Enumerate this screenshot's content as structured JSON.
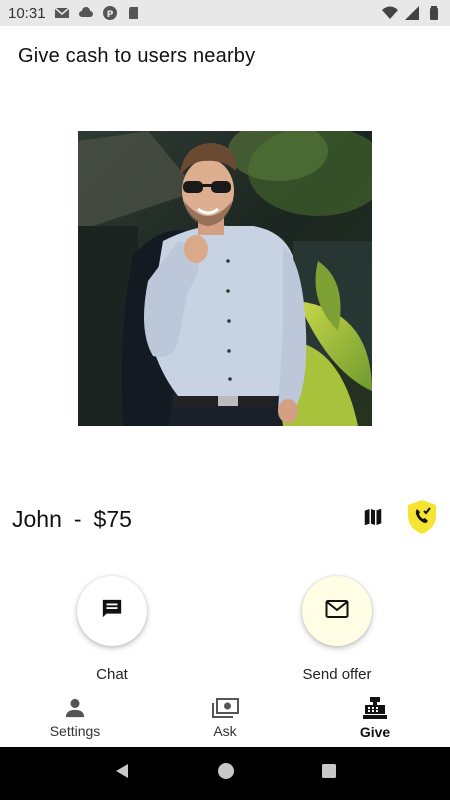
{
  "status_bar": {
    "time": "10:31"
  },
  "header": {
    "title": "Give cash to users nearby"
  },
  "profile": {
    "name": "John",
    "separator": "-",
    "amount": "$75",
    "photo_description": "smiling man in light blue shirt and sunglasses holding a jacket over his shoulder"
  },
  "actions": {
    "chat_label": "Chat",
    "send_offer_label": "Send offer"
  },
  "bottom_nav": {
    "items": [
      {
        "label": "Settings",
        "icon": "person-icon"
      },
      {
        "label": "Ask",
        "icon": "cash-icon"
      },
      {
        "label": "Give",
        "icon": "cash-register-icon",
        "active": true
      }
    ]
  },
  "colors": {
    "accent_yellow": "#f5e532",
    "offer_fab_bg": "#fffde4"
  }
}
